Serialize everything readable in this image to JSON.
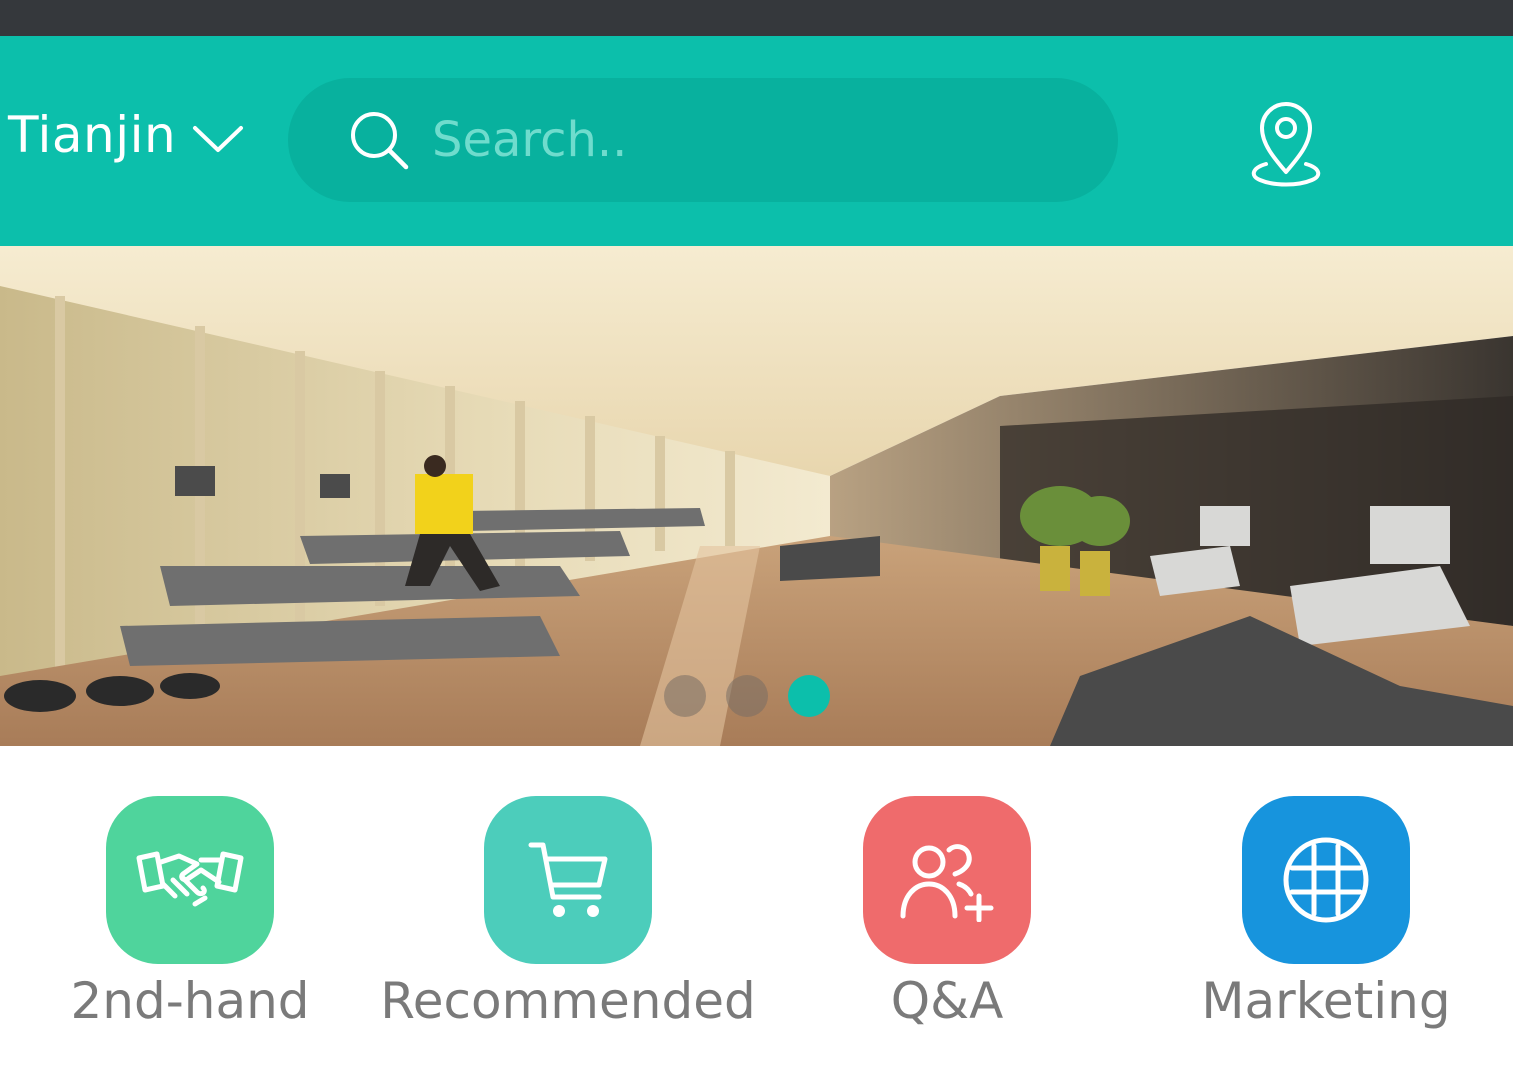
{
  "header": {
    "city": "Tianjin",
    "search_placeholder": "Search.."
  },
  "icons": {
    "city_dropdown": "chevron-down-icon",
    "search": "search-icon",
    "location": "location-pin-icon"
  },
  "banner": {
    "slide_count": 3,
    "active_slide": 3
  },
  "categories": [
    {
      "label": "2nd-hand",
      "icon": "handshake-icon",
      "color": "#4fd49c"
    },
    {
      "label": "Recommended",
      "icon": "cart-icon",
      "color": "#4ccdbb"
    },
    {
      "label": "Q&A",
      "icon": "add-user-icon",
      "color": "#ef6b6c"
    },
    {
      "label": "Marketing",
      "icon": "grid-icon",
      "color": "#1794dd"
    }
  ],
  "colors": {
    "status_bar": "#35383c",
    "header": "#0cbfab",
    "search_box": "#08b19e",
    "active_dot": "#0cbfab",
    "category_label": "#7a7a7a"
  }
}
